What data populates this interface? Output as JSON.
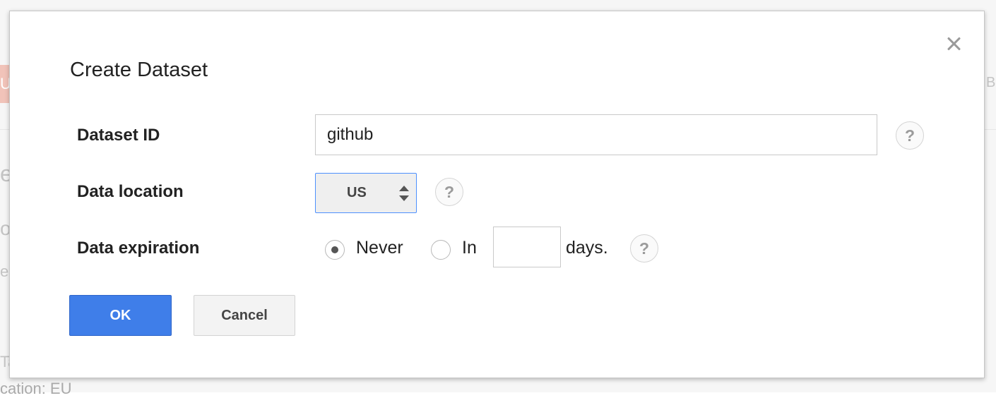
{
  "dialog": {
    "title": "Create Dataset",
    "fields": {
      "dataset_id_label": "Dataset ID",
      "dataset_id_value": "github",
      "location_label": "Data location",
      "location_value": "US",
      "expiration_label": "Data expiration",
      "never_label": "Never",
      "in_label": "In",
      "days_value": "",
      "days_suffix": "days."
    },
    "help_glyph": "?",
    "buttons": {
      "ok": "OK",
      "cancel": "Cancel"
    }
  },
  "background": {
    "fragment_1": "e",
    "fragment_2": "ot",
    "fragment_3": "e",
    "fragment_4": "Ta",
    "fragment_5": "cation: EU",
    "fragment_6": "B",
    "badge": "U"
  },
  "colors": {
    "primary_button": "#3f7ee9",
    "focus_border": "#4d90fe",
    "text": "#222222"
  },
  "icons": {
    "close": "close-icon",
    "help": "help-icon",
    "select_arrows": "select-arrows-icon"
  }
}
